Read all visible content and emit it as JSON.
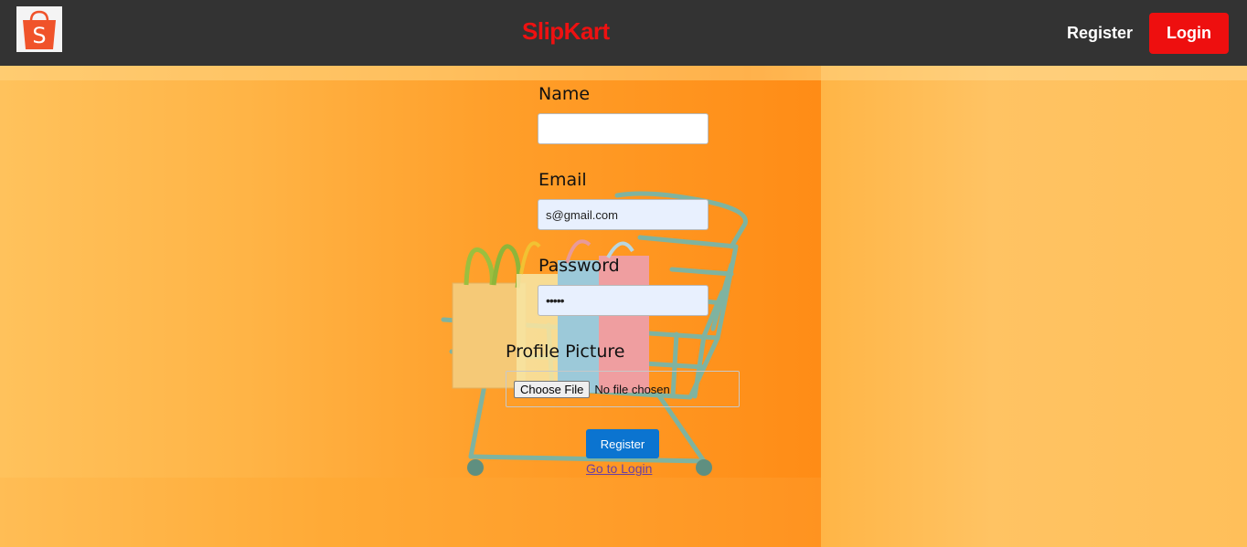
{
  "header": {
    "brand": "SlipKart",
    "logo_icon": "shopping-bag-icon",
    "register_label": "Register",
    "login_label": "Login",
    "colors": {
      "bar": "#333333",
      "brand": "#ee1111",
      "login_bg": "#ee0f0f"
    }
  },
  "form": {
    "name_label": "Name",
    "name_value": "",
    "email_label": "Email",
    "email_value": "s@gmail.com",
    "password_label": "Password",
    "password_value": "•••••",
    "picture_label": "Profile Picture",
    "file_button_label": "Choose File",
    "file_status": "No file chosen",
    "submit_label": "Register",
    "login_link": "Go to Login",
    "colors": {
      "submit_bg": "#0b74d0",
      "autofill_bg": "#e8f0fe"
    }
  },
  "background": {
    "illustration": "shopping-cart-with-bags"
  }
}
